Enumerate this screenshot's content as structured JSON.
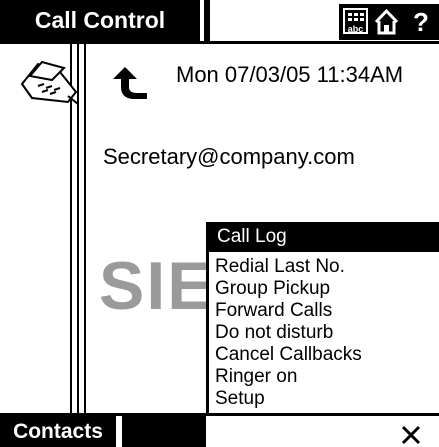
{
  "topbar": {
    "title": "Call Control",
    "keyboard_icon": "keyboard-abc-icon",
    "home_icon": "home-icon",
    "help_glyph": "?"
  },
  "header": {
    "phone_icon": "phone-icon",
    "call_direction_icon": "outgoing-call-arrow-icon",
    "datetime": "Mon 07/03/05 11:34AM",
    "user_address": "Secretary@company.com"
  },
  "watermark": {
    "text": "SIE"
  },
  "call_log_menu": {
    "title": "Call Log",
    "items": [
      "Redial Last No.",
      "Group Pickup",
      "Forward Calls",
      "Do not disturb",
      "Cancel Callbacks",
      "Ringer on",
      "Setup"
    ]
  },
  "bottombar": {
    "contacts_label": "Contacts",
    "close_icon": "close-icon"
  }
}
